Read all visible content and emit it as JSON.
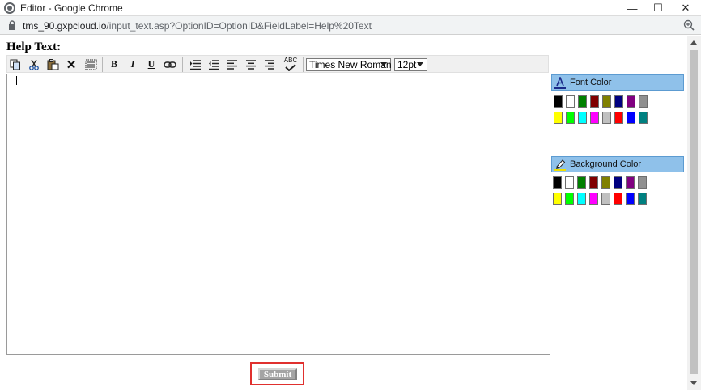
{
  "window": {
    "title": "Editor - Google Chrome",
    "minimize": "—",
    "maximize": "☐",
    "close": "✕"
  },
  "address": {
    "host": "tms_90.gxpcloud.io",
    "path": "/input_text.asp?OptionID=OptionID&FieldLabel=Help%20Text"
  },
  "page": {
    "label": "Help Text:"
  },
  "toolbar": {
    "bold": "B",
    "italic": "I",
    "underline": "U",
    "spell": "ABC",
    "font_family": "Times New Roman",
    "font_size": "12pt",
    "icons": [
      "copy-icon",
      "cut-icon",
      "paste-icon",
      "delete-icon",
      "select-all-icon",
      "bold-icon",
      "italic-icon",
      "underline-icon",
      "link-icon",
      "indent-icon",
      "outdent-icon",
      "align-left-icon",
      "align-center-icon",
      "align-right-icon",
      "spellcheck-icon"
    ]
  },
  "font_color": {
    "label": "Font Color",
    "row1": [
      "#000000",
      "#ffffff",
      "#008000",
      "#800000",
      "#808000",
      "#000080",
      "#800080",
      "#909090"
    ],
    "row2": [
      "#ffff00",
      "#00ff00",
      "#00ffff",
      "#ff00ff",
      "#c0c0c0",
      "#ff0000",
      "#0000ff",
      "#008080"
    ]
  },
  "background_color": {
    "label": "Background Color",
    "row1": [
      "#000000",
      "#ffffff",
      "#008000",
      "#800000",
      "#808000",
      "#000080",
      "#800080",
      "#909090"
    ],
    "row2": [
      "#ffff00",
      "#00ff00",
      "#00ffff",
      "#ff00ff",
      "#c0c0c0",
      "#ff0000",
      "#0000ff",
      "#008080"
    ]
  },
  "submit": {
    "label": "Submit"
  },
  "colors": {
    "highlight_border": "#e0302e",
    "panel_header": "#8fc1ea"
  }
}
